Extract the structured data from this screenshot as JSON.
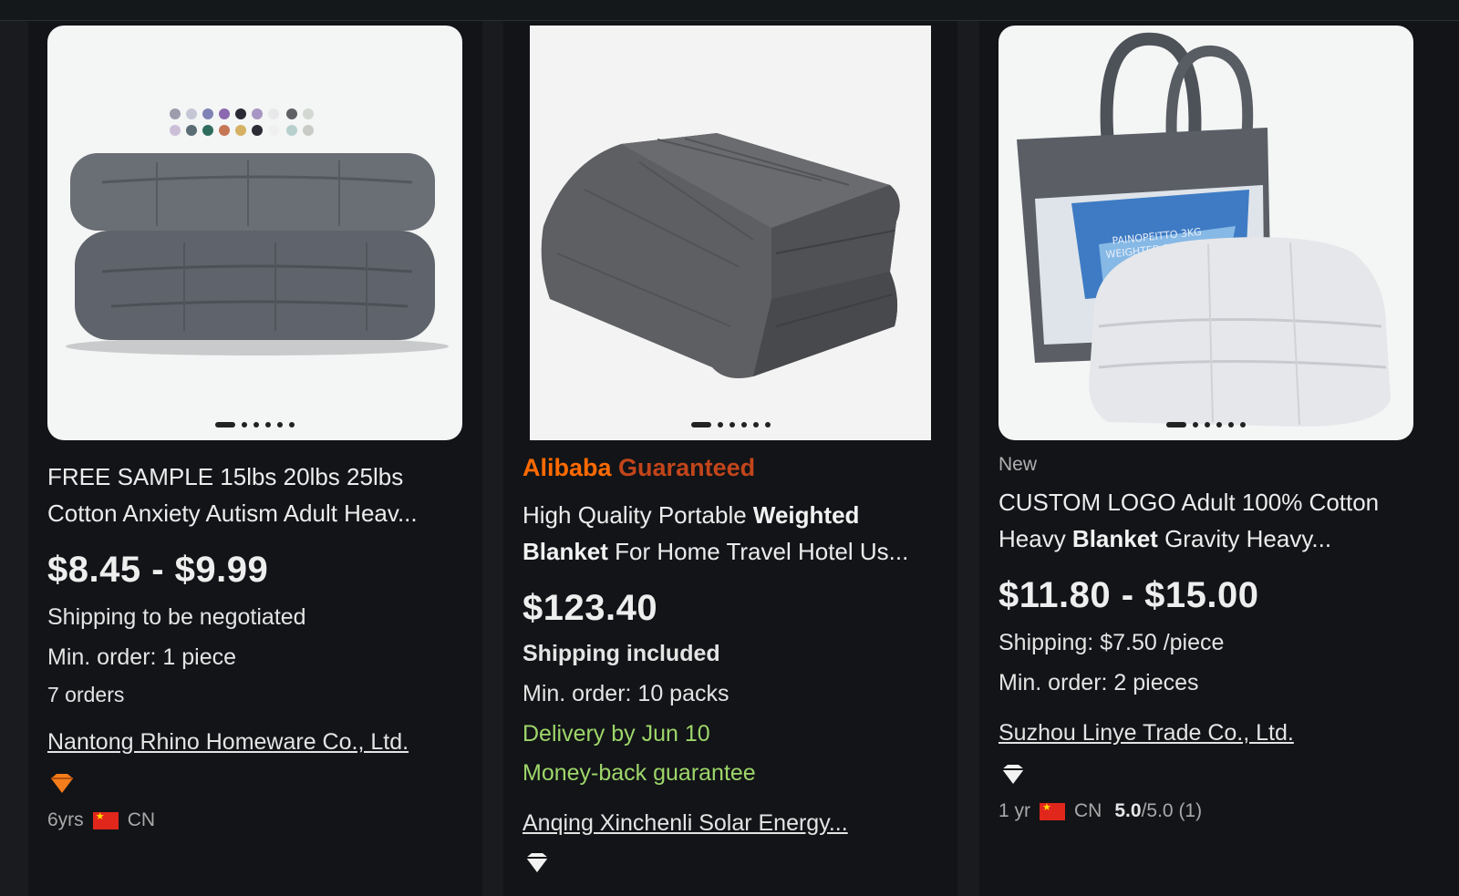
{
  "products": [
    {
      "title": "FREE SAMPLE 15lbs 20lbs 25lbs Cotton Anxiety Autism Adult Heav...",
      "price": "$8.45 - $9.99",
      "shipping": "Shipping to be negotiated",
      "min_order": "Min. order: 1 piece",
      "orders": "7 orders",
      "supplier": "Nantong Rhino Homeware Co., Ltd.",
      "years": "6yrs",
      "country": "CN",
      "icon": "orange-diamond-icon"
    },
    {
      "badge_a": "Alibaba",
      "badge_b": "Guaranteed",
      "title_pre": "High Quality Portable ",
      "title_bold1": "Weighted",
      "title_bold2": "Blanket",
      "title_post": " For Home Travel Hotel Us...",
      "price": "$123.40",
      "shipping": "Shipping included",
      "min_order": "Min. order: 10 packs",
      "delivery": "Delivery by Jun 10",
      "guarantee": "Money-back guarantee",
      "supplier": "Anqing Xinchenli Solar Energy...",
      "icon": "white-diamond-icon"
    },
    {
      "new_tag": "New",
      "title_pre": "CUSTOM LOGO Adult 100% Cotton Heavy ",
      "title_bold": "Blanket",
      "title_post": " Gravity Heavy...",
      "price": "$11.80 - $15.00",
      "shipping": "Shipping: $7.50 /piece",
      "min_order": "Min. order: 2 pieces",
      "supplier": "Suzhou Linye Trade Co., Ltd.",
      "years": "1 yr",
      "country": "CN",
      "rating": "5.0",
      "rating_max": "/5.0",
      "rating_count": "(1)",
      "bag_label_1": "PAINOPEITTO 3KG",
      "bag_label_2": "WEIGHTED BLANKET",
      "icon": "white-diamond-icon"
    }
  ],
  "colors": {
    "background": "#191b1f",
    "card": "#121417",
    "accent_orange": "#ff6a00",
    "green": "#9ed66a"
  }
}
